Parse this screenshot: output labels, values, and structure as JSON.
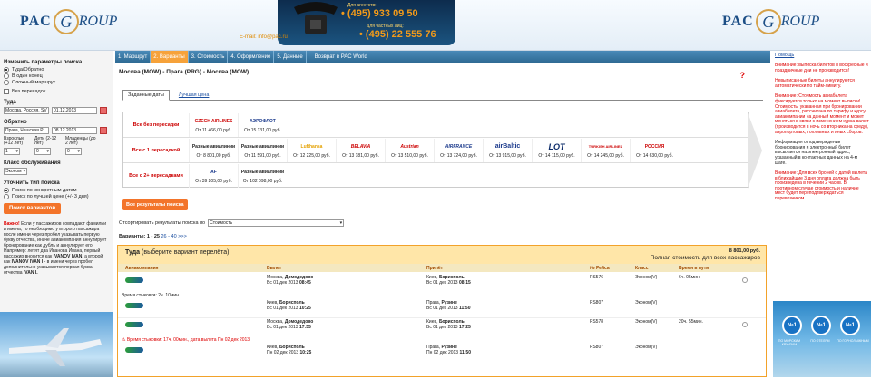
{
  "header": {
    "logo_pac": "PAC",
    "logo_letter": "G",
    "logo_group": "ROUP",
    "email": "E-mail: info@pac.ru",
    "agent_label": "Для агентств:",
    "agent_phone": "(495) 933 09 50",
    "private_label": "Для частных лиц:",
    "private_phone": "(495) 22 555 76"
  },
  "sidebar": {
    "title": "Изменить параметры поиска",
    "trip_roundtrip": "Туда/Обратно",
    "trip_oneway": "В один конец",
    "trip_complex": "Сложный маршрут",
    "no_transfers": "Без пересадок",
    "to_label": "Туда",
    "to_city": "Москва, Россия, SV",
    "to_date": "01.12.2013",
    "back_label": "Обратно",
    "back_city": "Прага, Чешская Р",
    "back_date": "08.12.2013",
    "adults_label": "Взрослые (+12 лет)",
    "children_label": "Дети (2-12 лет)",
    "infants_label": "Младенцы (до 2 лет)",
    "adults": "1",
    "children": "0",
    "infants": "0",
    "class_label": "Класс обслуживания",
    "class_value": "Эконом",
    "refine_label": "Уточнить тип поиска",
    "refine_exact": "Поиск по конкретным датам",
    "refine_best": "Поиск по лучшей цене (+/- 3 дня)",
    "search_button": "Поиск вариантов",
    "warning_title": "Важно!",
    "warning_text": "Если у пассажиров совпадают фамилии и имена, то необходимо у второго пассажира после имени через пробел указывать первую букву отчества, иначе авиакомпания аннулирует бронирование как дубль и аннулирует его. Например: летят два Иванова Ивана, первый пассажир вносится как",
    "warning_example1": "IVANOV IVAN",
    "warning_mid": ", а второй как",
    "warning_example2": "IVANOV IVAN I",
    "warning_tail": "- в имени через пробел дополнительно указывается первая буква отчества",
    "warning_example3": "IVAN I."
  },
  "steps": [
    {
      "label": "1. Маршрут"
    },
    {
      "label": "2. Варианты"
    },
    {
      "label": "3. Стоимость"
    },
    {
      "label": "4. Оформление"
    },
    {
      "label": "5. Данные"
    },
    {
      "label": "Возврат в PAC World"
    }
  ],
  "route": "Москва (MOW) - Прага (PRG) - Москва (MOW)",
  "question_mark": "?",
  "subtabs": {
    "active": "Заданные даты",
    "link": "Лучшая цена"
  },
  "matrix": {
    "rows": [
      {
        "label": "Все без пересадки",
        "cells": [
          {
            "airline": "CZECH AIRLINES",
            "price": "От 11 466,00 руб."
          },
          {
            "airline": "АЭРОФЛОТ",
            "price": "От 15 131,00 руб."
          }
        ]
      },
      {
        "label": "Все с 1 пересадкой",
        "cells": [
          {
            "airline": "Разные авиалинии",
            "price": "От 8 801,00 руб."
          },
          {
            "airline": "Разные авиалинии",
            "price": "От 11 591,00 руб."
          },
          {
            "airline": "Lufthansa",
            "price": "От 12 225,00 руб."
          },
          {
            "airline": "BELAVIA",
            "price": "От 13 181,00 руб."
          },
          {
            "airline": "Austrian",
            "price": "От 13 510,00 руб."
          },
          {
            "airline": "AIRFRANCE",
            "price": "От 13 724,00 руб."
          },
          {
            "airline": "airBaltic",
            "price": "От 13 915,00 руб."
          },
          {
            "airline": "LOT",
            "price": "От 14 115,00 руб."
          },
          {
            "airline": "TURKISH AIRLINES",
            "price": "От 14 245,00 руб."
          },
          {
            "airline": "РОССИЯ",
            "price": "От 14 630,00 руб."
          }
        ]
      },
      {
        "label": "Все с 2+ пересадками",
        "cells": [
          {
            "airline": "AF",
            "price": "От 39 205,00 руб."
          },
          {
            "airline": "Разные авиалинии",
            "price": "От 102 098,00 руб."
          }
        ]
      }
    ]
  },
  "all_results_button": "Все результаты поиска",
  "sort": {
    "label": "Отсортировать результаты поиска по",
    "value": "Стоимость"
  },
  "variants": {
    "label": "Варианты: 1 - 25",
    "range": "26 - 40",
    "next": ">>>"
  },
  "panel": {
    "title": "Туда",
    "subtitle": "(выберите вариант перелёта)",
    "total_price": "8 801,00 руб.",
    "total_label": "Полная стоимость для всех пассажиров",
    "columns": [
      "Авиакомпания",
      "Вылет",
      "Прилёт",
      "№ Рейса",
      "Класс",
      "Время в пути"
    ],
    "flights": [
      {
        "dep_city": "Москва,",
        "dep_airport": "Домодедово",
        "dep_time": "Вс 01 дек 2013",
        "dep_hour": "08:45",
        "arr_city": "Киев,",
        "arr_airport": "Борисполь",
        "arr_time": "Вс 01 дек 2013",
        "arr_hour": "08:15",
        "flight": "PS576",
        "class": "Эконом(V)",
        "duration": "6ч. 05мин."
      },
      {
        "dep_city": "Киев,",
        "dep_airport": "Борисполь",
        "dep_time": "Вс 01 дек 2013",
        "dep_hour": "10:25",
        "arr_city": "Прага,",
        "arr_airport": "Рузине",
        "arr_time": "Вс 01 дек 2013",
        "arr_hour": "11:50",
        "flight": "PS807",
        "class": "Эконом(V)",
        "duration": ""
      },
      {
        "dep_city": "Москва,",
        "dep_airport": "Домодедово",
        "dep_time": "Вс 01 дек 2013",
        "dep_hour": "17:55",
        "arr_city": "Киев,",
        "arr_airport": "Борисполь",
        "arr_time": "Вс 01 дек 2013",
        "arr_hour": "17:25",
        "flight": "PS578",
        "class": "Эконом(V)",
        "duration": "20ч. 55мин."
      },
      {
        "dep_city": "Киев,",
        "dep_airport": "Борисполь",
        "dep_time": "Пн 02 дек 2013",
        "dep_hour": "10:25",
        "arr_city": "Прага,",
        "arr_airport": "Рузине",
        "arr_time": "Пн 02 дек 2013",
        "arr_hour": "11:50",
        "flight": "PS807",
        "class": "Эконом(V)",
        "duration": ""
      }
    ],
    "layover1": "Время стыковки: 2ч. 10мин.",
    "layover2": "Время стыковки: 17ч. 00мин., дата вылета Пн 02 дек 2013"
  },
  "right": {
    "help": "Помощь",
    "p1": "Внимание: выписка билетов в воскресные и праздничные дни не производится!",
    "p2": "Невыписанные билеты аннулируются автоматически по тайм-лимиту.",
    "p3": "Внимание: Стоимость авиабилета фиксируется только на момент выписки! Стоимость, указанная при бронировании авиабилета, рассчитана по тарифу и курсу авиакомпании на данный момент и может меняться в связи с изменением курса валют (производится в ночь со вторника на среду), аэропортовых, топливных и иных сборов.",
    "p4": "Информация о подтверждении бронирования и электронный билет высылается на электронный адрес, указанный в контактных данных на 4-м шаге.",
    "p5": "Внимание: Для всех броней с датой вылета в ближайшие 3 дня оплата должна быть произведена в течении 2 часов. В противном случае стоимость и наличие мест будет переподтверждаться перевозчиком.",
    "ad_badge": "№1",
    "ad_caption1": "ПО МОРСКИМ КРУИЗАМ",
    "ad_caption2": "ПО ОТЕЛЯМ",
    "ad_caption3": "ПО ГОРНОЛЫЖНЫМ"
  },
  "colors": {
    "accent": "#f3742a",
    "tab_bar": "#2d6891",
    "panel_border": "#f2a22a",
    "warning": "#dd0000"
  }
}
